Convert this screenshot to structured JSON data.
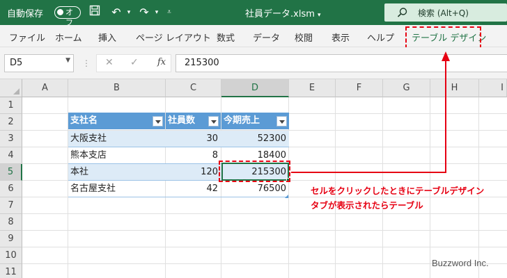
{
  "titlebar": {
    "autosave_label": "自動保存",
    "autosave_state": "オフ",
    "filename": "社員データ.xlsm",
    "search_label": "検索 (Alt+Q)",
    "bg_color": "#217346"
  },
  "ribbon": {
    "tabs": [
      "ファイル",
      "ホーム",
      "挿入",
      "ページ レイアウト",
      "数式",
      "データ",
      "校閲",
      "表示",
      "ヘルプ",
      "テーブル デザイン"
    ]
  },
  "formula_bar": {
    "name_box": "D5",
    "fx_label": "fx",
    "value": "215300"
  },
  "grid": {
    "columns": [
      "A",
      "B",
      "C",
      "D",
      "E",
      "F",
      "G",
      "H",
      "I"
    ],
    "rows": [
      "1",
      "2",
      "3",
      "4",
      "5",
      "6",
      "7",
      "8",
      "9",
      "10",
      "11"
    ],
    "selected_cell": "D5"
  },
  "table": {
    "headers": [
      "支社名",
      "社員数",
      "今期売上"
    ],
    "rows": [
      [
        "大阪支社",
        "30",
        "52300"
      ],
      [
        "熊本支店",
        "8",
        "18400"
      ],
      [
        "本社",
        "120",
        "215300"
      ],
      [
        "名古屋支社",
        "42",
        "76500"
      ]
    ],
    "header_color": "#5b9bd5",
    "band_color": "#ddebf7"
  },
  "annotation": {
    "line1": "セルをクリックしたときにテーブルデザイン",
    "line2": "タブが表示されたらテーブル",
    "color": "#e60012"
  },
  "watermark": "Buzzword Inc."
}
